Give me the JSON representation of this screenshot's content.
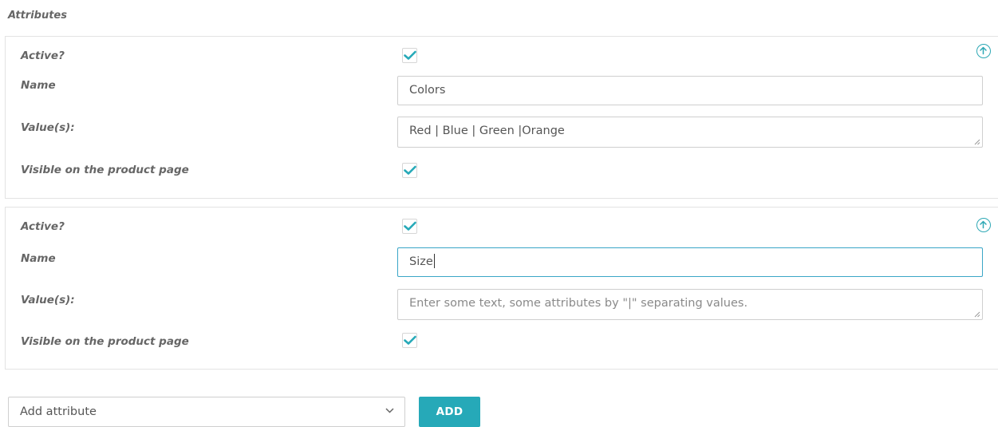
{
  "section": {
    "title": "Attributes"
  },
  "attributes": [
    {
      "active_label": "Active?",
      "name_label": "Name",
      "name_value": "Colors",
      "values_label": "Value(s):",
      "values_value": "Red | Blue | Green |Orange",
      "visible_label": "Visible on the product page",
      "active_checked": true,
      "visible_checked": true
    },
    {
      "active_label": "Active?",
      "name_label": "Name",
      "name_value": "Size",
      "values_label": "Value(s):",
      "values_placeholder": "Enter some text, some attributes by \"|\" separating values.",
      "visible_label": "Visible on the product page",
      "active_checked": true,
      "visible_checked": true
    }
  ],
  "footer": {
    "select_value": "Add attribute",
    "add_button_label": "ADD"
  },
  "colors": {
    "accent": "#26a9b8",
    "focus_border": "#3aa6c7"
  },
  "icons": {
    "collapse": "arrow-up-circle-icon",
    "check": "checkmark-icon",
    "dropdown": "chevron-down-icon",
    "resize": "resize-grip-icon"
  }
}
